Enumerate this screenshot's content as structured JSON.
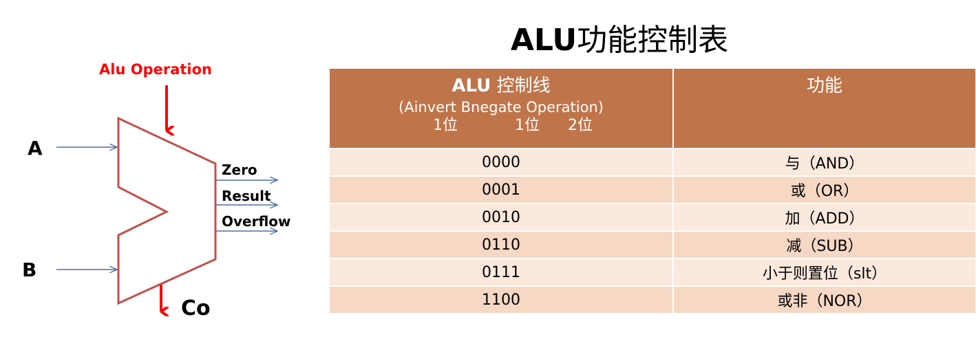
{
  "title": {
    "latin": "ALU",
    "cjk": "功能控制表"
  },
  "diagram": {
    "operation_label": "Alu Operation",
    "input_a": "A",
    "input_b": "B",
    "outputs": [
      "Zero",
      "Result",
      "Overflow"
    ],
    "carry_out": "Co",
    "colors": {
      "alu_outline": "#c0504d",
      "arrow_red": "#ff0000",
      "arrow_blue": "#4f6f9f"
    }
  },
  "table": {
    "header": {
      "control_title_latin": "ALU",
      "control_title_cjk": "控制线",
      "control_sub": "(Ainvert  Bnegate Operation)",
      "bits": [
        "1位",
        "1位",
        "2位"
      ],
      "function_title": "功能"
    },
    "rows": [
      {
        "code": "0000",
        "function": "与（AND）"
      },
      {
        "code": "0001",
        "function": "或（OR）"
      },
      {
        "code": "0010",
        "function": "加（ADD）"
      },
      {
        "code": "0110",
        "function": "减（SUB）"
      },
      {
        "code": "0111",
        "function": "小于则置位（slt）"
      },
      {
        "code": "1100",
        "function": "或非（NOR）"
      }
    ],
    "colors": {
      "header_bg": "#c0744a",
      "row_bg": "#f6d8c4"
    }
  }
}
